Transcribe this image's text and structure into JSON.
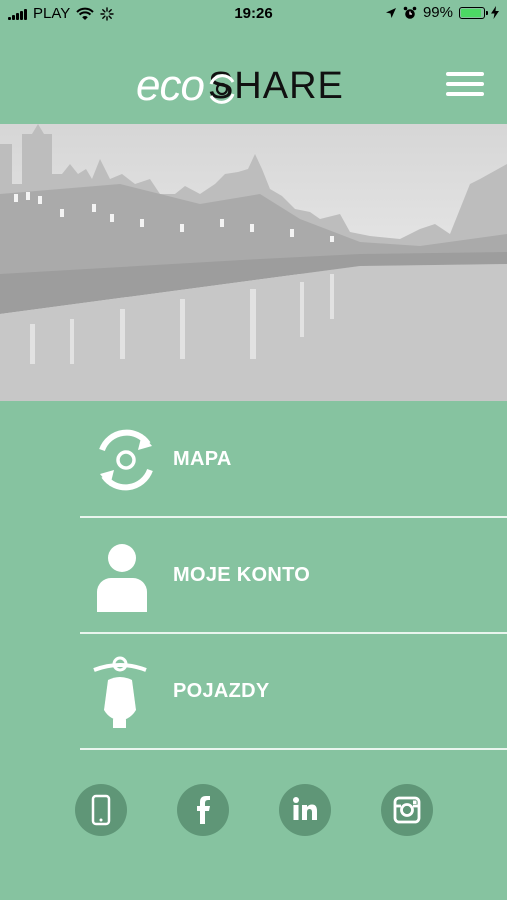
{
  "status_bar": {
    "carrier": "PLAY",
    "time": "19:26",
    "battery": "99%",
    "battery_level": 0.99
  },
  "header": {
    "logo_eco": "eco",
    "logo_share": "SHARE",
    "menu_icon": "hamburger-icon"
  },
  "menu": {
    "items": [
      {
        "label": "MAPA",
        "icon": "recycle-map-icon"
      },
      {
        "label": "MOJE KONTO",
        "icon": "user-icon"
      },
      {
        "label": "POJAZDY",
        "icon": "scooter-icon"
      }
    ]
  },
  "social": [
    {
      "icon": "phone-icon"
    },
    {
      "icon": "facebook-icon"
    },
    {
      "icon": "linkedin-icon"
    },
    {
      "icon": "instagram-icon"
    }
  ],
  "colors": {
    "background": "#86c3a0",
    "social_circle": "#5f9677",
    "divider": "#e9f5ee"
  }
}
